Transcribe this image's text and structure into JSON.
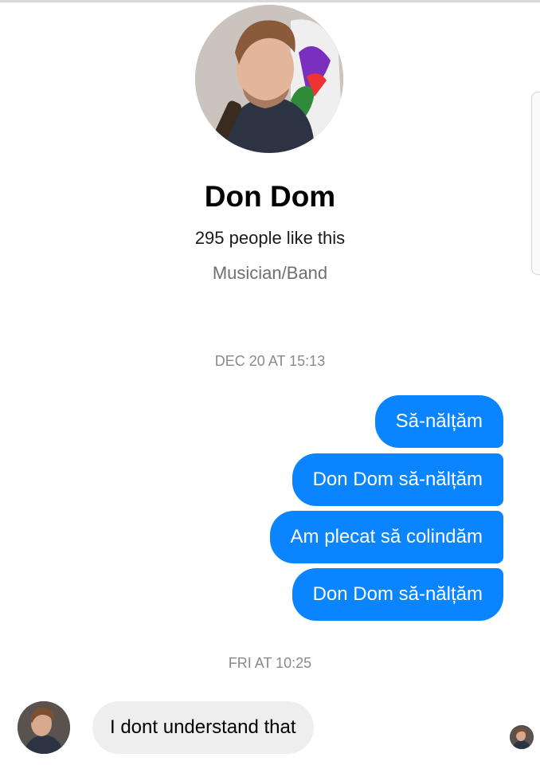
{
  "page": {
    "name": "Don Dom",
    "likes": "295 people like this",
    "category": "Musician/Band"
  },
  "conversation": {
    "groups": [
      {
        "timestamp": "DEC 20 AT 15:13",
        "outgoing": [
          "Să-nălțăm",
          "Don Dom să-nălțăm",
          "Am plecat să colindăm",
          "Don Dom să-nălțăm"
        ]
      },
      {
        "timestamp": "FRI AT 10:25",
        "incoming": [
          "I dont understand that"
        ]
      }
    ]
  },
  "colors": {
    "outgoing_bubble": "#0a84ff",
    "incoming_bubble": "#eeeeee",
    "timestamp_text": "#8a8a8a"
  },
  "icons": {
    "profile_photo": "profile-photo",
    "sender_avatar": "avatar",
    "seen_avatar": "read-receipt-avatar"
  }
}
